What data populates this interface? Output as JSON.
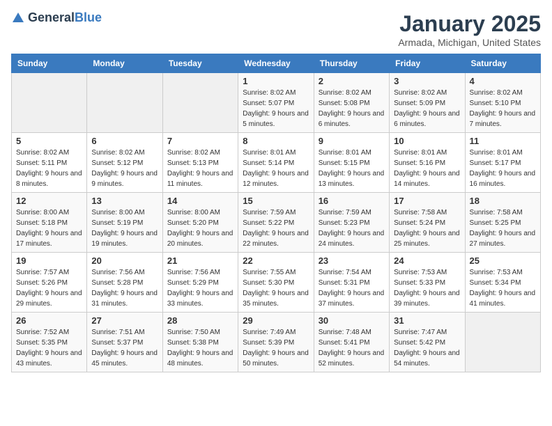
{
  "logo": {
    "general": "General",
    "blue": "Blue"
  },
  "header": {
    "month": "January 2025",
    "location": "Armada, Michigan, United States"
  },
  "weekdays": [
    "Sunday",
    "Monday",
    "Tuesday",
    "Wednesday",
    "Thursday",
    "Friday",
    "Saturday"
  ],
  "weeks": [
    [
      {
        "day": "",
        "sunrise": "",
        "sunset": "",
        "daylight": ""
      },
      {
        "day": "",
        "sunrise": "",
        "sunset": "",
        "daylight": ""
      },
      {
        "day": "",
        "sunrise": "",
        "sunset": "",
        "daylight": ""
      },
      {
        "day": "1",
        "sunrise": "Sunrise: 8:02 AM",
        "sunset": "Sunset: 5:07 PM",
        "daylight": "Daylight: 9 hours and 5 minutes."
      },
      {
        "day": "2",
        "sunrise": "Sunrise: 8:02 AM",
        "sunset": "Sunset: 5:08 PM",
        "daylight": "Daylight: 9 hours and 6 minutes."
      },
      {
        "day": "3",
        "sunrise": "Sunrise: 8:02 AM",
        "sunset": "Sunset: 5:09 PM",
        "daylight": "Daylight: 9 hours and 6 minutes."
      },
      {
        "day": "4",
        "sunrise": "Sunrise: 8:02 AM",
        "sunset": "Sunset: 5:10 PM",
        "daylight": "Daylight: 9 hours and 7 minutes."
      }
    ],
    [
      {
        "day": "5",
        "sunrise": "Sunrise: 8:02 AM",
        "sunset": "Sunset: 5:11 PM",
        "daylight": "Daylight: 9 hours and 8 minutes."
      },
      {
        "day": "6",
        "sunrise": "Sunrise: 8:02 AM",
        "sunset": "Sunset: 5:12 PM",
        "daylight": "Daylight: 9 hours and 9 minutes."
      },
      {
        "day": "7",
        "sunrise": "Sunrise: 8:02 AM",
        "sunset": "Sunset: 5:13 PM",
        "daylight": "Daylight: 9 hours and 11 minutes."
      },
      {
        "day": "8",
        "sunrise": "Sunrise: 8:01 AM",
        "sunset": "Sunset: 5:14 PM",
        "daylight": "Daylight: 9 hours and 12 minutes."
      },
      {
        "day": "9",
        "sunrise": "Sunrise: 8:01 AM",
        "sunset": "Sunset: 5:15 PM",
        "daylight": "Daylight: 9 hours and 13 minutes."
      },
      {
        "day": "10",
        "sunrise": "Sunrise: 8:01 AM",
        "sunset": "Sunset: 5:16 PM",
        "daylight": "Daylight: 9 hours and 14 minutes."
      },
      {
        "day": "11",
        "sunrise": "Sunrise: 8:01 AM",
        "sunset": "Sunset: 5:17 PM",
        "daylight": "Daylight: 9 hours and 16 minutes."
      }
    ],
    [
      {
        "day": "12",
        "sunrise": "Sunrise: 8:00 AM",
        "sunset": "Sunset: 5:18 PM",
        "daylight": "Daylight: 9 hours and 17 minutes."
      },
      {
        "day": "13",
        "sunrise": "Sunrise: 8:00 AM",
        "sunset": "Sunset: 5:19 PM",
        "daylight": "Daylight: 9 hours and 19 minutes."
      },
      {
        "day": "14",
        "sunrise": "Sunrise: 8:00 AM",
        "sunset": "Sunset: 5:20 PM",
        "daylight": "Daylight: 9 hours and 20 minutes."
      },
      {
        "day": "15",
        "sunrise": "Sunrise: 7:59 AM",
        "sunset": "Sunset: 5:22 PM",
        "daylight": "Daylight: 9 hours and 22 minutes."
      },
      {
        "day": "16",
        "sunrise": "Sunrise: 7:59 AM",
        "sunset": "Sunset: 5:23 PM",
        "daylight": "Daylight: 9 hours and 24 minutes."
      },
      {
        "day": "17",
        "sunrise": "Sunrise: 7:58 AM",
        "sunset": "Sunset: 5:24 PM",
        "daylight": "Daylight: 9 hours and 25 minutes."
      },
      {
        "day": "18",
        "sunrise": "Sunrise: 7:58 AM",
        "sunset": "Sunset: 5:25 PM",
        "daylight": "Daylight: 9 hours and 27 minutes."
      }
    ],
    [
      {
        "day": "19",
        "sunrise": "Sunrise: 7:57 AM",
        "sunset": "Sunset: 5:26 PM",
        "daylight": "Daylight: 9 hours and 29 minutes."
      },
      {
        "day": "20",
        "sunrise": "Sunrise: 7:56 AM",
        "sunset": "Sunset: 5:28 PM",
        "daylight": "Daylight: 9 hours and 31 minutes."
      },
      {
        "day": "21",
        "sunrise": "Sunrise: 7:56 AM",
        "sunset": "Sunset: 5:29 PM",
        "daylight": "Daylight: 9 hours and 33 minutes."
      },
      {
        "day": "22",
        "sunrise": "Sunrise: 7:55 AM",
        "sunset": "Sunset: 5:30 PM",
        "daylight": "Daylight: 9 hours and 35 minutes."
      },
      {
        "day": "23",
        "sunrise": "Sunrise: 7:54 AM",
        "sunset": "Sunset: 5:31 PM",
        "daylight": "Daylight: 9 hours and 37 minutes."
      },
      {
        "day": "24",
        "sunrise": "Sunrise: 7:53 AM",
        "sunset": "Sunset: 5:33 PM",
        "daylight": "Daylight: 9 hours and 39 minutes."
      },
      {
        "day": "25",
        "sunrise": "Sunrise: 7:53 AM",
        "sunset": "Sunset: 5:34 PM",
        "daylight": "Daylight: 9 hours and 41 minutes."
      }
    ],
    [
      {
        "day": "26",
        "sunrise": "Sunrise: 7:52 AM",
        "sunset": "Sunset: 5:35 PM",
        "daylight": "Daylight: 9 hours and 43 minutes."
      },
      {
        "day": "27",
        "sunrise": "Sunrise: 7:51 AM",
        "sunset": "Sunset: 5:37 PM",
        "daylight": "Daylight: 9 hours and 45 minutes."
      },
      {
        "day": "28",
        "sunrise": "Sunrise: 7:50 AM",
        "sunset": "Sunset: 5:38 PM",
        "daylight": "Daylight: 9 hours and 48 minutes."
      },
      {
        "day": "29",
        "sunrise": "Sunrise: 7:49 AM",
        "sunset": "Sunset: 5:39 PM",
        "daylight": "Daylight: 9 hours and 50 minutes."
      },
      {
        "day": "30",
        "sunrise": "Sunrise: 7:48 AM",
        "sunset": "Sunset: 5:41 PM",
        "daylight": "Daylight: 9 hours and 52 minutes."
      },
      {
        "day": "31",
        "sunrise": "Sunrise: 7:47 AM",
        "sunset": "Sunset: 5:42 PM",
        "daylight": "Daylight: 9 hours and 54 minutes."
      },
      {
        "day": "",
        "sunrise": "",
        "sunset": "",
        "daylight": ""
      }
    ]
  ]
}
